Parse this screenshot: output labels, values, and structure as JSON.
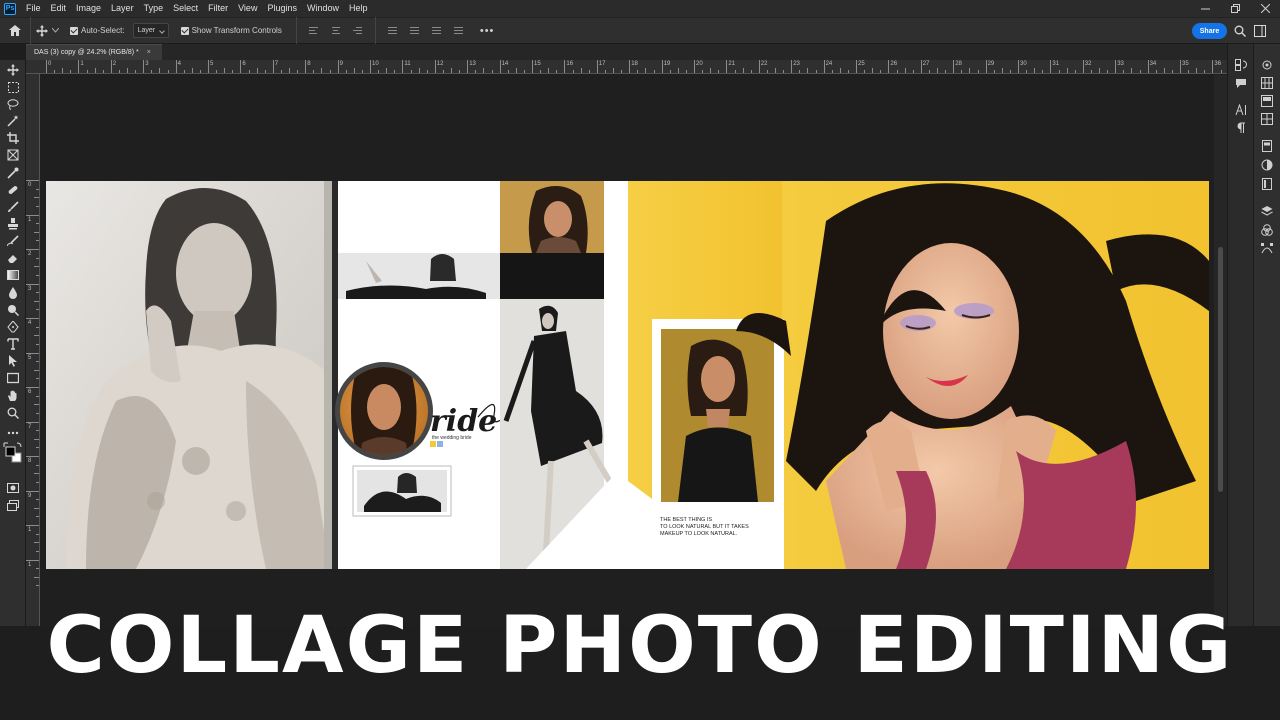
{
  "app": {
    "logo": "Ps"
  },
  "menu": [
    "File",
    "Edit",
    "Image",
    "Layer",
    "Type",
    "Select",
    "Filter",
    "View",
    "Plugins",
    "Window",
    "Help"
  ],
  "options": {
    "auto_select_label": "Auto-Select:",
    "layer_value": "Layer",
    "show_transform_label": "Show Transform Controls",
    "more": "•••",
    "share_label": "Share"
  },
  "document": {
    "tab_title": "DAS (3) copy @ 24.2% (RGB/8) *",
    "close_glyph": "×"
  },
  "ruler": {
    "top_labels": [
      "0",
      "1",
      "2",
      "3",
      "4",
      "5",
      "6",
      "7",
      "8",
      "9",
      "10",
      "11",
      "12",
      "13",
      "14",
      "15",
      "16",
      "17",
      "18",
      "19",
      "20",
      "21",
      "22",
      "23",
      "24",
      "25",
      "26",
      "27",
      "28",
      "29",
      "30",
      "31",
      "32",
      "33",
      "34",
      "35",
      "36"
    ],
    "left_labels": [
      "0",
      "1",
      "2",
      "3",
      "4",
      "5",
      "6",
      "7",
      "8",
      "9",
      "1",
      "1"
    ]
  },
  "collage": {
    "bride_word": "ride",
    "bride_sub": "the wedding bride",
    "quote_line1": "THE BEST THING IS",
    "quote_line2": "TO LOOK NATURAL BUT IT TAKES",
    "quote_line3": "MAKEUP TO LOOK NATURAL."
  },
  "overlay": {
    "title": "COLLAGE PHOTO EDITING"
  },
  "colors": {
    "accent_blue": "#1473e6",
    "canvas_yellow": "#f4c93a",
    "workspace": "#1f1f1f"
  }
}
